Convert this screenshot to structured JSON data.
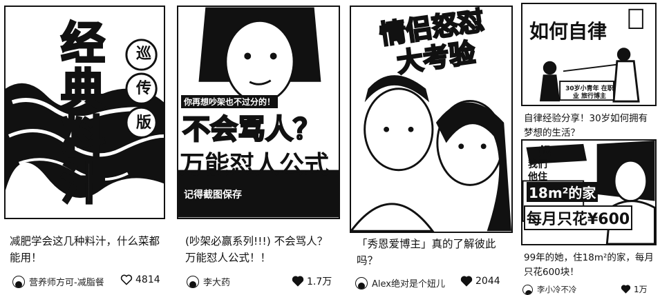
{
  "cards": [
    {
      "cover_text": [
        "经",
        "典",
        "料",
        "汁"
      ],
      "cover_badge": [
        "巡",
        "传",
        "版"
      ],
      "title": "减肥学会这几种料汁，什么菜都能用！",
      "author": "营养师方可-减脂餐",
      "likes": "4814",
      "liked": false
    },
    {
      "cover_top": "你再想吵架也不过分的！",
      "cover_headline": "不会骂人？",
      "cover_sub": "万能怼人公式",
      "cover_foot": "记得截图保存",
      "title": "(吵架必赢系列!!!) 不会骂人？万能怼人公式！！",
      "author": "李大药",
      "likes": "1.7万",
      "liked": true
    },
    {
      "cover_headline": "情侣怒怼大考验",
      "title": "「秀恩爱博主」真的了解彼此吗？",
      "author": "Alex绝对是个妞儿",
      "likes": "2044",
      "liked": true
    },
    {
      "cover_headline": "如何自律",
      "cover_sub": "30岁小青年 在职业 旅行博主",
      "title": "自律经验分享！30岁如何拥有梦想的生活？",
      "author": "",
      "likes": "",
      "liked": false
    },
    {
      "cover_lines": [
        "一起",
        "我们",
        "他住",
        "18m²的家",
        "每月只花¥600"
      ],
      "title": "99年的她，住18m²的家，每月只花600块！",
      "author": "李小冷不冷",
      "likes": "1万",
      "liked": true
    }
  ],
  "colors": {
    "ink": "#111111",
    "paper": "#ffffff"
  },
  "icons": {
    "like": "heart-icon",
    "avatar": "avatar"
  }
}
